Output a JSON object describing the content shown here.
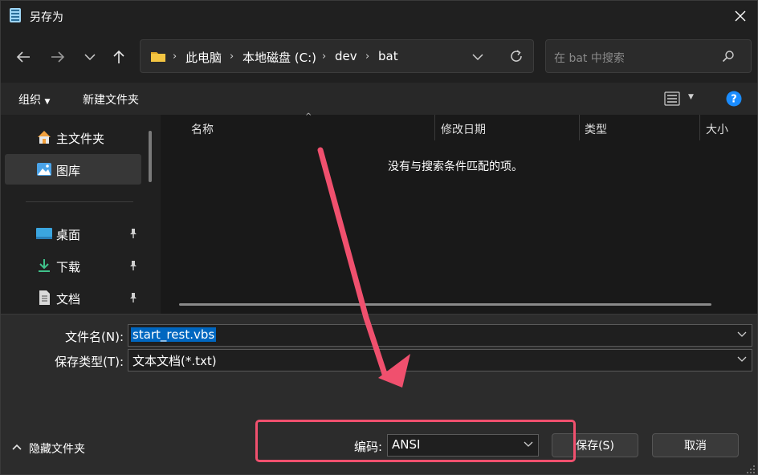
{
  "window": {
    "title": "另存为"
  },
  "address": {
    "segments": [
      "此电脑",
      "本地磁盘 (C:)",
      "dev",
      "bat"
    ]
  },
  "search": {
    "placeholder": "在 bat 中搜索"
  },
  "toolbar": {
    "organize_label": "组织",
    "new_folder_label": "新建文件夹"
  },
  "sidebar": {
    "items": [
      {
        "label": "主文件夹",
        "icon": "home-icon"
      },
      {
        "label": "图库",
        "icon": "gallery-icon",
        "selected": true
      },
      {
        "label": "桌面",
        "icon": "desktop-icon",
        "pinned": true
      },
      {
        "label": "下载",
        "icon": "download-icon",
        "pinned": true
      },
      {
        "label": "文档",
        "icon": "document-icon",
        "pinned": true
      }
    ]
  },
  "filelist": {
    "columns": [
      "名称",
      "修改日期",
      "类型",
      "大小"
    ],
    "empty_message": "没有与搜索条件匹配的项。"
  },
  "form": {
    "filename_label": "文件名(N):",
    "filename_value": "start_rest.vbs",
    "filetype_label": "保存类型(T):",
    "filetype_value": "文本文档(*.txt)",
    "encoding_label": "编码:",
    "encoding_value": "ANSI"
  },
  "footer": {
    "hide_folders_label": "隐藏文件夹",
    "save_label": "保存(S)",
    "cancel_label": "取消"
  },
  "colors": {
    "background": "#202020",
    "accent": "#0067c0",
    "annotation": "#f0506e",
    "help": "#1a8cff"
  }
}
